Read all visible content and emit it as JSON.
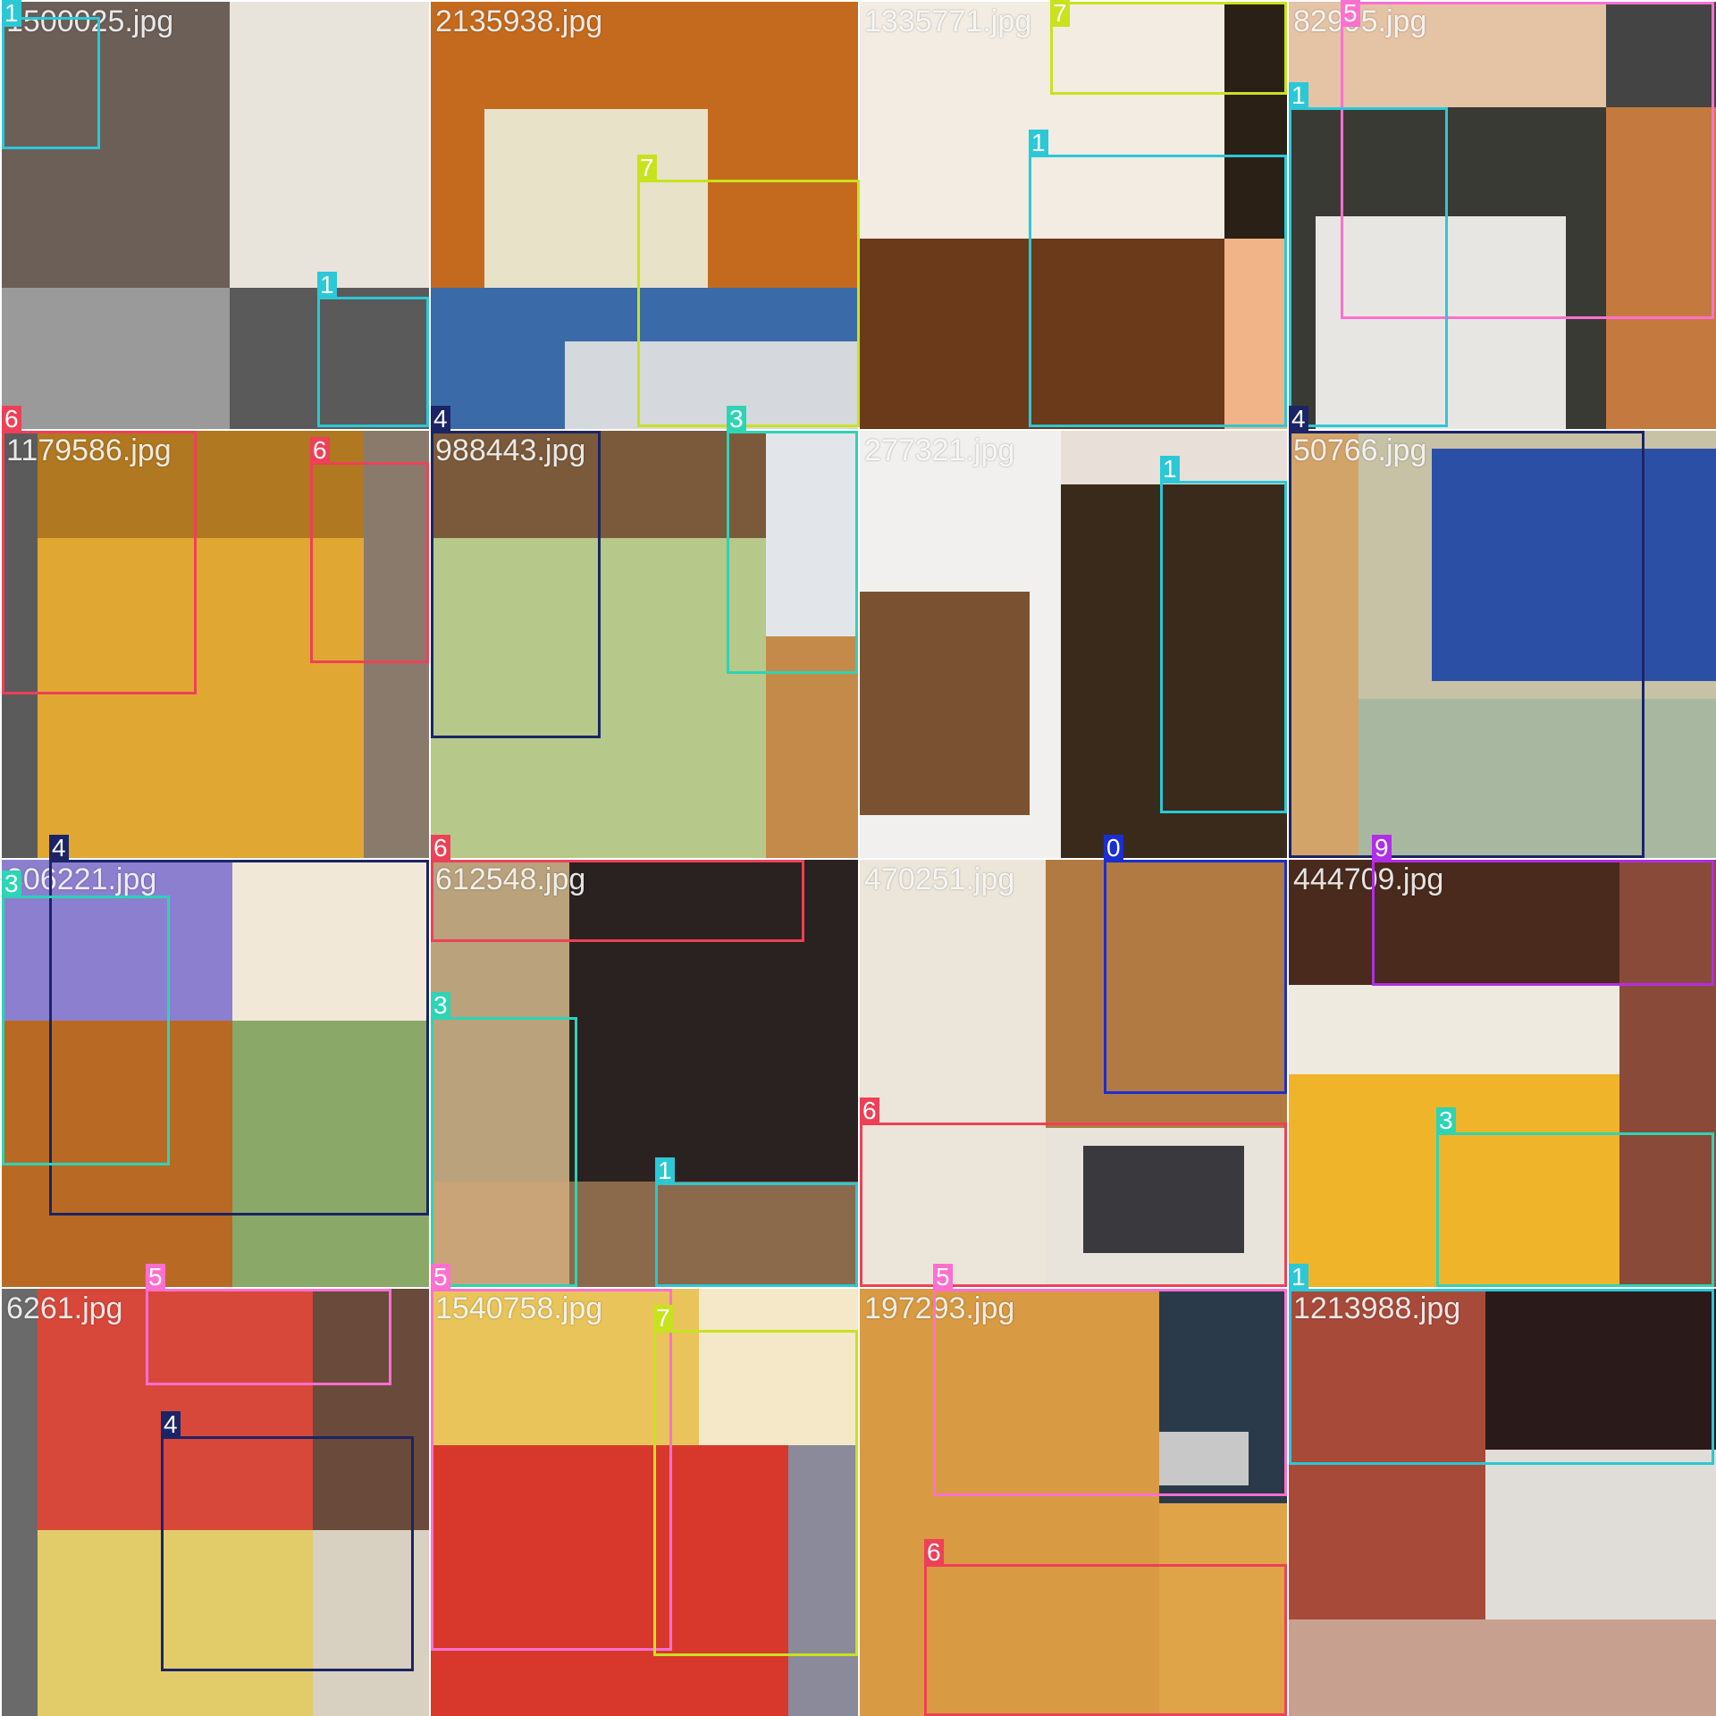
{
  "class_colors": {
    "0": "#1a2fd0",
    "1": "#2bc8d6",
    "3": "#2dd4b5",
    "4": "#1b2466",
    "5": "#ff6fd0",
    "6": "#ee4057",
    "7": "#c8e21d",
    "9": "#b12de6"
  },
  "tiles": [
    {
      "name": "1500025.jpg",
      "colors": [
        "#6b5f58",
        "#e8e4dc",
        "#9a9a9a",
        "#5a5a5a"
      ]
    },
    {
      "name": "2135938.jpg",
      "colors": [
        "#c46a1e",
        "#e7e2c8",
        "#3b6aa8",
        "#d5d9de"
      ]
    },
    {
      "name": "1335771.jpg",
      "colors": [
        "#f2ece2",
        "#2a2016",
        "#6a3a1a",
        "#f0b488"
      ]
    },
    {
      "name": "82995.jpg",
      "colors": [
        "#e5c3a5",
        "#3a3a34",
        "#e8e6e2",
        "#c47a3e"
      ]
    },
    {
      "name": "1179586.jpg",
      "colors": [
        "#5b5b5b",
        "#b07820",
        "#e0a732",
        "#8a7a6c"
      ]
    },
    {
      "name": "988443.jpg",
      "colors": [
        "#7a5a3a",
        "#b6c98a",
        "#e2e6ea",
        "#c48a4a"
      ]
    },
    {
      "name": "277321.jpg",
      "colors": [
        "#f2f0ee",
        "#3a2a1c",
        "#7a5232",
        "#e8e0d8"
      ]
    },
    {
      "name": "50766.jpg",
      "colors": [
        "#d2a46a",
        "#2c4fa6",
        "#c7c2a6",
        "#a8b8a0"
      ]
    },
    {
      "name": "306221.jpg",
      "colors": [
        "#8c7fd0",
        "#f2e8d8",
        "#b86a24",
        "#8aa868"
      ]
    },
    {
      "name": "612548.jpg",
      "colors": [
        "#b9a27c",
        "#2a2220",
        "#c8a478",
        "#8a6a4a"
      ]
    },
    {
      "name": "470251.jpg",
      "colors": [
        "#ece6da",
        "#b07a42",
        "#e8e4dc",
        "#3a3a3e"
      ]
    },
    {
      "name": "444709.jpg",
      "colors": [
        "#4a2a1c",
        "#eeeadf",
        "#f0b42a",
        "#8a4a3a"
      ]
    },
    {
      "name": "6261.jpg",
      "colors": [
        "#d8483a",
        "#6a4a3a",
        "#e2cc6a",
        "#d8d0c0"
      ]
    },
    {
      "name": "1540758.jpg",
      "colors": [
        "#e8c45a",
        "#f4e8c8",
        "#d8382c",
        "#8a8a9a"
      ]
    },
    {
      "name": "197293.jpg",
      "colors": [
        "#d89a42",
        "#2a3a4a",
        "#e0a448",
        "#c8c8c8"
      ]
    },
    {
      "name": "1213988.jpg",
      "colors": [
        "#a84a3a",
        "#2a1a1a",
        "#e0ddd8",
        "#c8a090"
      ]
    }
  ],
  "detections": [
    {
      "cls": "1"
    },
    {
      "cls": "1"
    },
    {
      "cls": "7"
    },
    {
      "cls": "7"
    },
    {
      "cls": "1"
    },
    {
      "cls": "5"
    },
    {
      "cls": "1"
    },
    {
      "cls": "6"
    },
    {
      "cls": "6"
    },
    {
      "cls": "4"
    },
    {
      "cls": "3"
    },
    {
      "cls": "1"
    },
    {
      "cls": "4"
    },
    {
      "cls": "4"
    },
    {
      "cls": "3"
    },
    {
      "cls": "6"
    },
    {
      "cls": "3"
    },
    {
      "cls": "1"
    },
    {
      "cls": "0"
    },
    {
      "cls": "6"
    },
    {
      "cls": "9"
    },
    {
      "cls": "3"
    },
    {
      "cls": "5"
    },
    {
      "cls": "4"
    },
    {
      "cls": "5"
    },
    {
      "cls": "7"
    },
    {
      "cls": "5"
    },
    {
      "cls": "6"
    },
    {
      "cls": "1"
    }
  ]
}
